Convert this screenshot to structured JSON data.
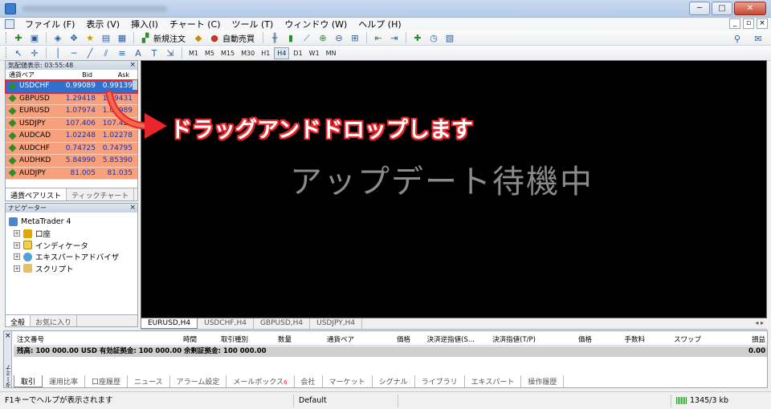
{
  "menu": {
    "items": [
      "ファイル (F)",
      "表示 (V)",
      "挿入(I)",
      "チャート (C)",
      "ツール (T)",
      "ウィンドウ (W)",
      "ヘルプ (H)"
    ]
  },
  "toolbar": {
    "new_order": "新規注文",
    "auto_trade": "自動売買",
    "timeframes": [
      "M1",
      "M5",
      "M15",
      "M30",
      "H1",
      "H4",
      "D1",
      "W1",
      "MN"
    ],
    "active_timeframe": "H4"
  },
  "market_watch": {
    "title": "気配値表示: 03:55:48",
    "col_symbol": "通貨ペア",
    "col_bid": "Bid",
    "col_ask": "Ask",
    "rows": [
      {
        "symbol": "USDCHF",
        "bid": "0.99089",
        "ask": "0.99139"
      },
      {
        "symbol": "GBPUSD",
        "bid": "1.29418",
        "ask": "1.29431"
      },
      {
        "symbol": "EURUSD",
        "bid": "1.07974",
        "ask": "1.07989"
      },
      {
        "symbol": "USDJPY",
        "bid": "107.406",
        "ask": "107.429"
      },
      {
        "symbol": "AUDCAD",
        "bid": "1.02248",
        "ask": "1.02278"
      },
      {
        "symbol": "AUDCHF",
        "bid": "0.74725",
        "ask": "0.74795"
      },
      {
        "symbol": "AUDHKD",
        "bid": "5.84990",
        "ask": "5.85390"
      },
      {
        "symbol": "AUDJPY",
        "bid": "81.005",
        "ask": "81.035"
      }
    ],
    "tabs": [
      "通貨ペアリスト",
      "ティックチャート"
    ]
  },
  "navigator": {
    "title": "ナビゲーター",
    "root": "MetaTrader 4",
    "items": [
      "口座",
      "インディケータ",
      "エキスパートアドバイザ",
      "スクリプト"
    ],
    "tabs": [
      "全般",
      "お気に入り"
    ]
  },
  "chart": {
    "message": "アップデート待機中",
    "callout": "ドラッグアンドドロップします",
    "tabs": [
      "EURUSD,H4",
      "USDCHF,H4",
      "GBPUSD,H4",
      "USDJPY,H4"
    ]
  },
  "terminal": {
    "side_label": "ターミナル",
    "columns": [
      "注文番号",
      "時間",
      "取引種別",
      "数量",
      "通貨ペア",
      "価格",
      "決済逆指値(S...",
      "決済指値(T/P)",
      "価格",
      "手数料",
      "スワップ",
      "損益"
    ],
    "balance": "残高: 100 000.00 USD  有効証拠金: 100 000.00  余剰証拠金: 100 000.00",
    "profit": "0.00",
    "tabs": [
      "取引",
      "運用比率",
      "口座履歴",
      "ニュース",
      "アラーム設定",
      "メールボックス",
      "会社",
      "マーケット",
      "シグナル",
      "ライブラリ",
      "エキスパート",
      "操作履歴"
    ],
    "mailbox_badge": "6"
  },
  "status": {
    "help": "F1キーでヘルプが表示されます",
    "profile": "Default",
    "traffic": "1345/3 kb"
  },
  "colors": {
    "accent_red": "#e8262b",
    "row_highlight": "#f7a07c",
    "selected": "#2f6fcf"
  }
}
